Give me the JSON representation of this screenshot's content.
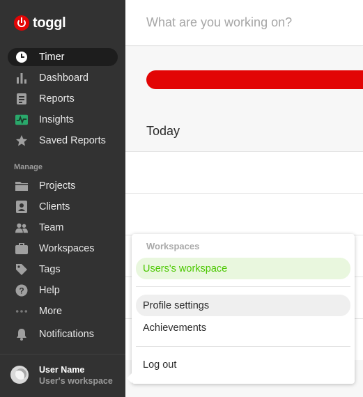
{
  "app": {
    "name": "toggl"
  },
  "colors": {
    "brand": "#e20505",
    "sidebar": "#323232",
    "workspace_green": "#4bc800"
  },
  "sidebar": {
    "items": [
      {
        "label": "Timer",
        "icon": "clock-icon"
      },
      {
        "label": "Dashboard",
        "icon": "bar-chart-icon"
      },
      {
        "label": "Reports",
        "icon": "document-icon"
      },
      {
        "label": "Insights",
        "icon": "pulse-icon"
      },
      {
        "label": "Saved Reports",
        "icon": "star-icon"
      }
    ],
    "manage_label": "Manage",
    "manage_items": [
      {
        "label": "Projects",
        "icon": "folder-icon"
      },
      {
        "label": "Clients",
        "icon": "contact-card-icon"
      },
      {
        "label": "Team",
        "icon": "people-icon"
      },
      {
        "label": "Workspaces",
        "icon": "briefcase-icon"
      },
      {
        "label": "Tags",
        "icon": "tag-icon"
      },
      {
        "label": "Help",
        "icon": "question-icon"
      },
      {
        "label": "More",
        "icon": "ellipsis-icon"
      }
    ],
    "notifications_label": "Notifications",
    "user": {
      "name": "User Name",
      "workspace": "User's workspace"
    }
  },
  "main": {
    "timer_placeholder": "What are you working on?",
    "today_label": "Today"
  },
  "popup": {
    "section_label": "Workspaces",
    "workspace_item": "Users's workspace",
    "profile_settings": "Profile settings",
    "achievements": "Achievements",
    "logout": "Log out"
  }
}
